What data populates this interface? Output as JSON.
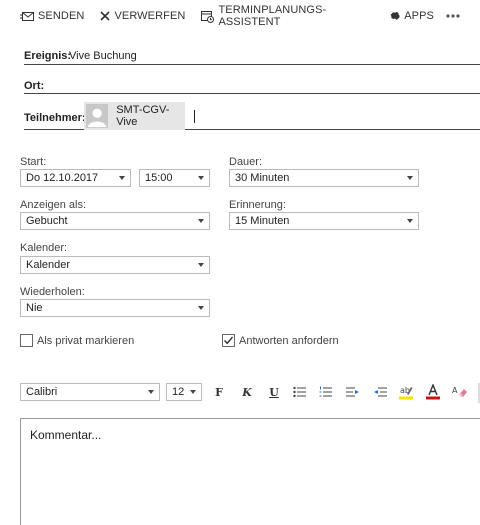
{
  "toolbar": {
    "send_label": "SENDEN",
    "discard_label": "VERWERFEN",
    "scheduling_label": "TERMINPLANUNGS-ASSISTENT",
    "apps_label": "APPS"
  },
  "form": {
    "event_label": "Ereignis:",
    "event_value": "Vive Buchung",
    "location_label": "Ort:",
    "location_value": "",
    "attendees_label": "Teilnehmer:",
    "attendee_name": "SMT-CGV-Vive"
  },
  "details": {
    "start_label": "Start:",
    "start_date": "Do 12.10.2017",
    "start_time": "15:00",
    "duration_label": "Dauer:",
    "duration_value": "30 Minuten",
    "show_as_label": "Anzeigen als:",
    "show_as_value": "Gebucht",
    "reminder_label": "Erinnerung:",
    "reminder_value": "15 Minuten",
    "calendar_label": "Kalender:",
    "calendar_value": "Kalender",
    "repeat_label": "Wiederholen:",
    "repeat_value": "Nie"
  },
  "options": {
    "private_label": "Als privat markieren",
    "private_checked": false,
    "request_responses_label": "Antworten anfordern",
    "request_responses_checked": true
  },
  "formatting": {
    "font_name": "Calibri",
    "font_size": "12",
    "bold_glyph": "F",
    "italic_glyph": "K",
    "underline_glyph": "U"
  },
  "comment": {
    "placeholder": "Kommentar..."
  },
  "colors": {
    "highlight": "#f5e400",
    "font_color": "#d01010",
    "border": "#bbbbbb"
  }
}
